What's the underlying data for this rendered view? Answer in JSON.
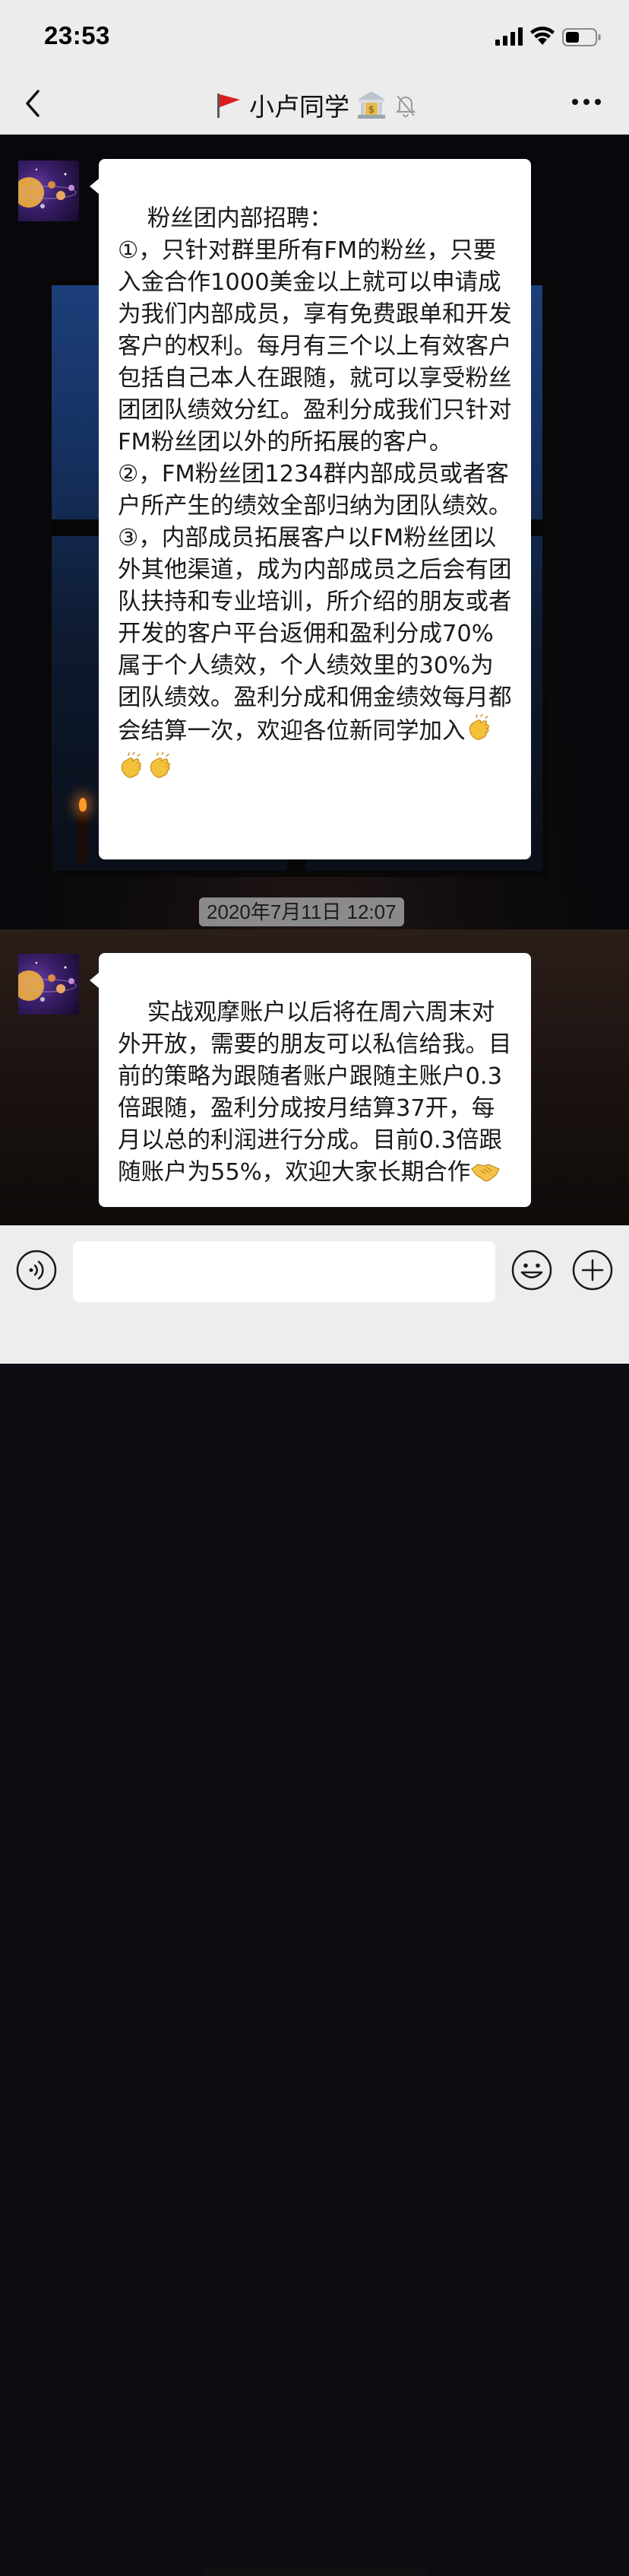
{
  "status_bar": {
    "time": "23:53",
    "icons": [
      "signal-icon",
      "wifi-icon",
      "battery-icon"
    ]
  },
  "nav": {
    "title": "小卢同学",
    "icons": [
      "back-icon",
      "red-flag-icon",
      "bank-icon",
      "mute-bell-icon",
      "more-icon"
    ]
  },
  "messages": [
    {
      "avatar": "solar-system-avatar",
      "text": "粉丝团内部招聘：\n①，只针对群里所有FM的粉丝，只要入金合作1000美金以上就可以申请成为我们内部成员，享有免费跟单和开发客户的权利。每月有三个以上有效客户包括自己本人在跟随，就可以享受粉丝团团队绩效分红。盈利分成我们只针对FM粉丝团以外的所拓展的客户。\n②，FM粉丝团1234群内部成员或者客户所产生的绩效全部归纳为团队绩效。\n③，内部成员拓展客户以FM粉丝团以外其他渠道，成为内部成员之后会有团队扶持和专业培训，所介绍的朋友或者开发的客户平台返佣和盈利分成70%属于个人绩效，个人绩效里的30%为团队绩效。盈利分成和佣金绩效每月都会结算一次，欢迎各位新同学加入",
      "trailing_emoji": [
        "clapping-hands-emoji",
        "clapping-hands-emoji",
        "clapping-hands-emoji"
      ]
    },
    {
      "avatar": "solar-system-avatar",
      "text": "实战观摩账户以后将在周六周末对外开放，需要的朋友可以私信给我。目前的策略为跟随者账户跟随主账户0.3倍跟随，盈利分成按月结算37开，每月以总的利润进行分成。目前0.3倍跟随账户为55%，欢迎大家长期合作",
      "trailing_emoji": [
        "handshake-emoji"
      ]
    }
  ],
  "timestamp": "2020年7月11日 12:07",
  "input_bar": {
    "value": "",
    "icons": [
      "voice-icon",
      "emoji-icon",
      "plus-icon"
    ]
  },
  "colors": {
    "bar_bg": "#ececec",
    "bubble_bg": "#ffffff",
    "timestamp_bg": "#a0a0a0"
  }
}
